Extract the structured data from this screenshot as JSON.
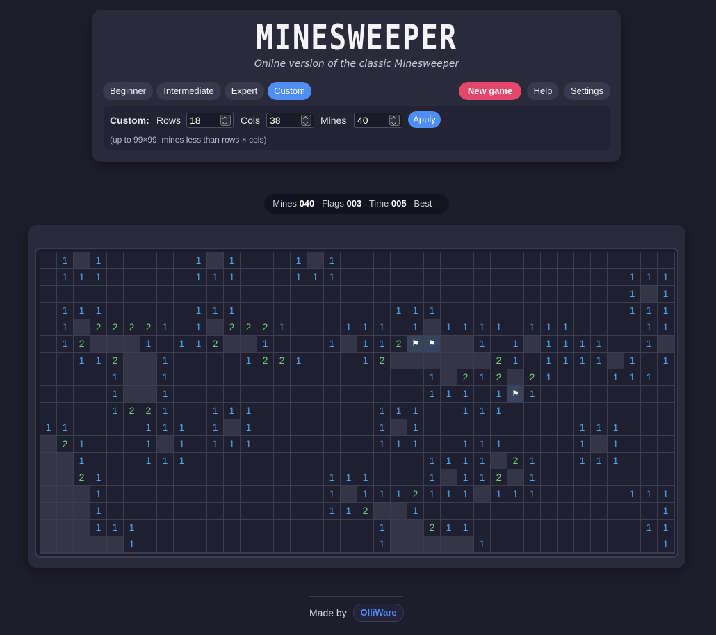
{
  "header": {
    "title": "MINESWEEPER",
    "subtitle": "Online version of the classic Minesweeper"
  },
  "difficulty": {
    "beginner": "Beginner",
    "intermediate": "Intermediate",
    "expert": "Expert",
    "custom": "Custom",
    "selected": "Custom"
  },
  "actions": {
    "new_game": "New game",
    "help": "Help",
    "settings": "Settings"
  },
  "custom": {
    "label": "Custom:",
    "rows_label": "Rows",
    "rows_value": "18",
    "cols_label": "Cols",
    "cols_value": "38",
    "mines_label": "Mines",
    "mines_value": "40",
    "apply": "Apply",
    "hint": "(up to 99×99, mines less than rows × cols)"
  },
  "status": {
    "mines_label": "Mines",
    "mines_value": "040",
    "flags_label": "Flags",
    "flags_value": "003",
    "time_label": "Time",
    "time_value": "005",
    "best_label": "Best",
    "best_value": "--"
  },
  "board": {
    "rows": 18,
    "cols": 38,
    "legend": "._ = revealed empty, # = hidden, F = flag, digit = count",
    "grid": [
      ".1#1.....1#1...1#1....................",
      ".111.....111...111.................111",
      "...................................1#1",
      ".111.....111.........111...........111",
      ".1#22221.1#2221...111.1#1111.111....11",
      ".12###1.112##1...1#112FF##1.1#1111..1#",
      "..112##1....1221...12######21.1111#1.11",
      "....1##1...............1#212#21...111..",
      "....1##1...............111.1F1..........",
      "....1221..111.......111..111.........",
      "11....111.1#1.......1#1.........111...",
      "#21...1#1.111.......111..111....1#1...",
      "##1...111..............1111#21..111...",
      "##21.............111...1#112#1........",
      "###1.............1#1112111#111.....111",
      "###1.............112##1..............1##",
      "###111..............1##211..........1111##",
      "#####1..............1#####1..........1######"
    ]
  },
  "footer": {
    "made_by": "Made by",
    "link": "OlliWare"
  },
  "colors": {
    "accent": "#4f8ef2",
    "danger": "#e5466c",
    "number_1": "#4aa6f0",
    "number_2": "#6fcf7f"
  },
  "icons": {
    "flag": "flag-icon"
  }
}
